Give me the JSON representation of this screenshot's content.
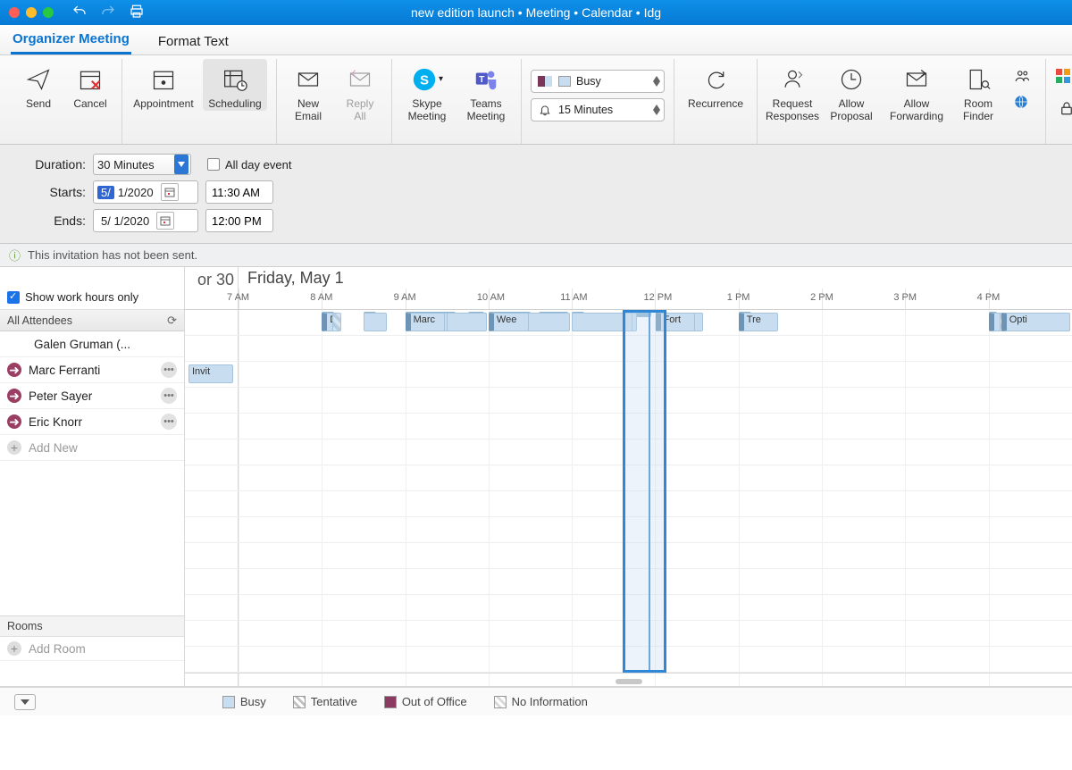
{
  "window_title": "new edition launch • Meeting • Calendar • Idg",
  "tabs": {
    "organizer": "Organizer Meeting",
    "format": "Format Text"
  },
  "ribbon": {
    "send": "Send",
    "cancel": "Cancel",
    "appointment": "Appointment",
    "scheduling": "Scheduling",
    "newemail": "New\nEmail",
    "replyall": "Reply\nAll",
    "skype": "Skype\nMeeting",
    "teams": "Teams\nMeeting",
    "busy": "Busy",
    "reminder": "15 Minutes",
    "recurrence": "Recurrence",
    "reqresp": "Request\nResponses",
    "allowprop": "Allow\nProposal",
    "allowfwd": "Allow\nForwarding",
    "roomfind": "Room\nFinder"
  },
  "form": {
    "duration_label": "Duration:",
    "duration_value": "30 Minutes",
    "allday": "All day event",
    "starts_label": "Starts:",
    "starts_date": "5/ 1/2020",
    "starts_date_sel": "5/",
    "starts_time": "11:30 AM",
    "ends_label": "Ends:",
    "ends_date": "5/ 1/2020",
    "ends_time": "12:00 PM"
  },
  "info_msg": "This invitation has not been sent.",
  "show_work_hours": "Show work hours only",
  "all_attendees": "All Attendees",
  "attendees": [
    {
      "name": "Galen Gruman (..."
    },
    {
      "name": "Marc Ferranti"
    },
    {
      "name": "Peter Sayer"
    },
    {
      "name": "Eric Knorr"
    }
  ],
  "add_new": "Add New",
  "rooms_label": "Rooms",
  "add_room": "Add Room",
  "prev_day": "or 30",
  "current_day": "Friday, May 1",
  "hours": [
    "7 AM",
    "8 AM",
    "9 AM",
    "10 AM",
    "11 AM",
    "12 PM",
    "1 PM",
    "2 PM",
    "3 PM",
    "4 PM"
  ],
  "events": {
    "r0": [
      {
        "l": "Marc"
      },
      {
        "l": "Opti"
      }
    ],
    "r1": [
      {
        "l": "Invit"
      },
      {
        "l": "Marc"
      },
      {
        "l": "Fort"
      }
    ],
    "r3": [
      {
        "l": "D"
      },
      {
        "l": "Wee"
      },
      {
        "l": "Fort"
      },
      {
        "l": "Tre"
      },
      {
        "l": "Opti"
      }
    ]
  },
  "legend": {
    "busy": "Busy",
    "tentative": "Tentative",
    "oof": "Out of Office",
    "noinfo": "No Information"
  }
}
